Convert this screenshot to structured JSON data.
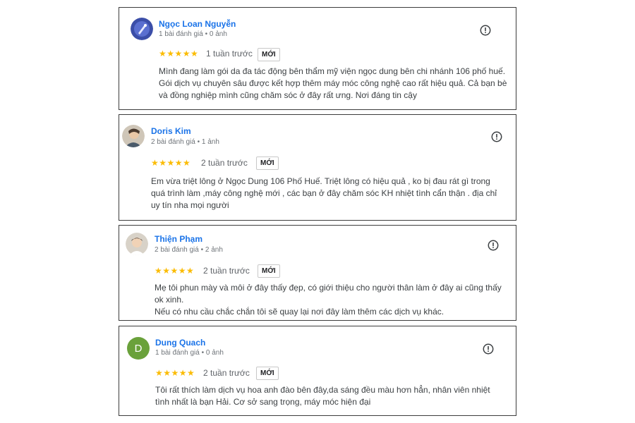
{
  "badge_label": "MỚI",
  "stars": "★★★★★",
  "reviews": [
    {
      "name": "Ngọc Loan Nguyễn",
      "meta": "1 bài đánh giá • 0 ảnh",
      "time": "1 tuần trước",
      "rating": 5,
      "avatar_icon": "photo-avatar",
      "lines": [
        "Mình đang làm gói da đa tác động bên thẩm mỹ viện ngọc dung bên chi nhánh 106 phố huế.",
        "Gói dịch vụ chuyên sâu được kết hợp thêm máy móc công nghệ cao rất hiệu quả. Cả bạn bè",
        "và đồng nghiệp mình cũng chăm sóc ở đây rất ưng. Nơi đáng tin cậy"
      ]
    },
    {
      "name": "Doris Kim",
      "meta": "2 bài đánh giá • 1 ảnh",
      "time": "2 tuần trước",
      "rating": 5,
      "avatar_icon": "photo-avatar",
      "lines": [
        "Em vừa triệt lông ở Ngọc Dung 106 Phố Huế. Triệt lông có hiệu quả , ko bị đau rát gì trong",
        "quá trình làm ,máy công nghệ mới , các bạn ở đây chăm sóc KH nhiệt tình cẩn thận . địa chỉ",
        "uy tín nha mọi người"
      ]
    },
    {
      "name": "Thiện Phạm",
      "meta": "2 bài đánh giá • 2 ảnh",
      "time": "2 tuần trước",
      "rating": 5,
      "avatar_icon": "photo-avatar",
      "lines": [
        "Mẹ tôi phun mày và môi ở đây thấy đẹp, có giới thiệu cho người thân làm ở đây ai cũng thấy",
        "ok xinh.",
        "Nếu có nhu cầu chắc chắn tôi sẽ quay lại nơi đây làm thêm các dịch vụ khác."
      ]
    },
    {
      "name": "Dung Quach",
      "meta": "1 bài đánh giá • 0 ảnh",
      "time": "2 tuần trước",
      "rating": 5,
      "avatar_letter": "D",
      "lines": [
        "Tôi rất thích làm dịch vụ hoa anh đào bên đây,da sáng đều màu hơn hẳn, nhân viên nhiệt",
        "tình nhất là bạn Hải. Cơ sở sang trọng, máy móc hiện đại"
      ]
    }
  ],
  "colors": {
    "name": "#1a73e8",
    "star": "#fbbc04",
    "avatar_letter_bg": "#6aa13b"
  }
}
